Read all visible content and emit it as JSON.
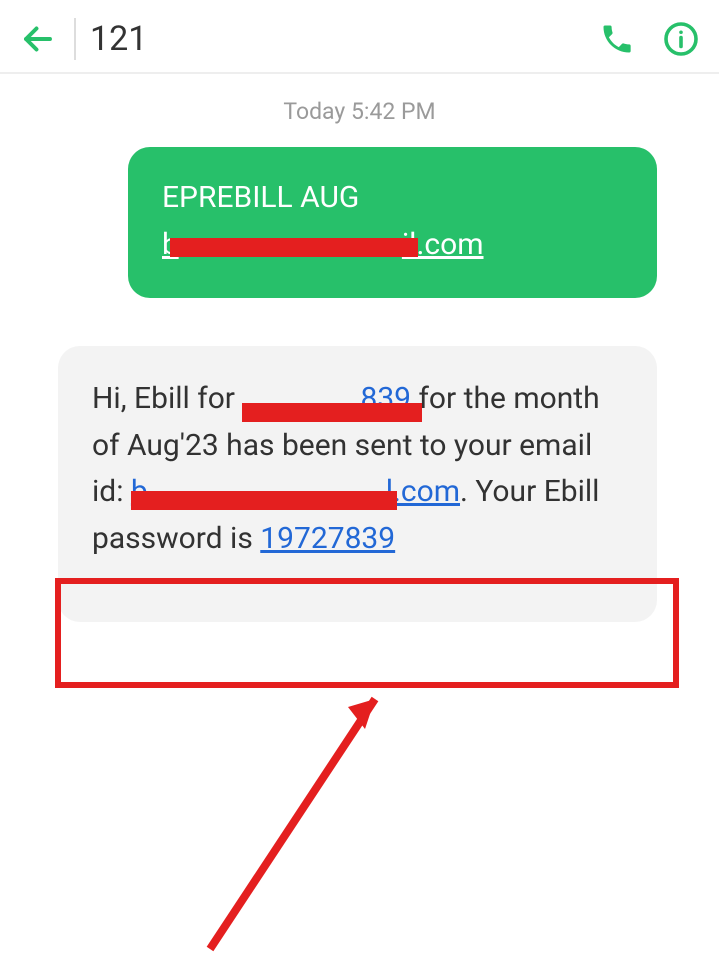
{
  "header": {
    "contact": "121"
  },
  "conversation": {
    "timestamp": "Today 5:42 PM",
    "outgoing": {
      "line1": "EPREBILL AUG",
      "email_prefix": "b",
      "email_suffix": "il.com"
    },
    "incoming": {
      "text1": "Hi, Ebill for ",
      "phone_visible": "839",
      "text2": " for the month of Aug'23 has been sent to your email id: ",
      "email_prefix": "b",
      "email_suffix": "l.com",
      "text3": ". Your Ebill password is ",
      "password": "19727839"
    }
  }
}
